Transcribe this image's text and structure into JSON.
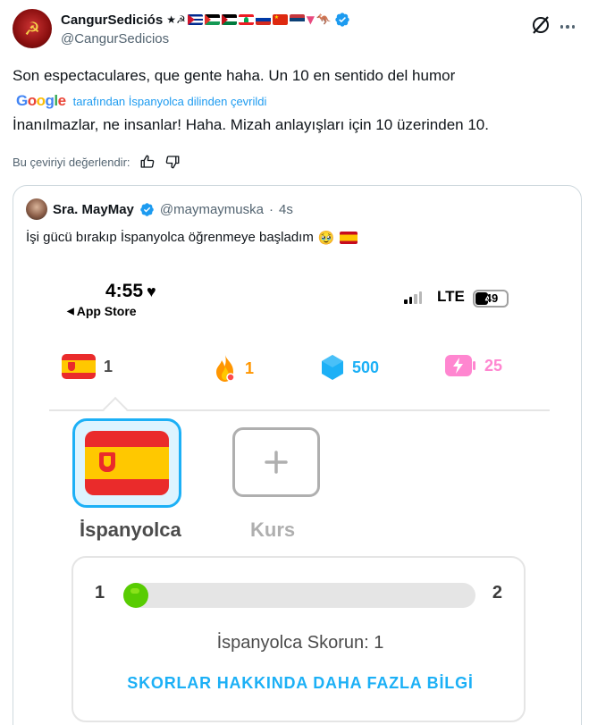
{
  "post": {
    "author": {
      "display_name": "CangurSediciós",
      "symbols": "★☭",
      "handle": "@CangurSedicios"
    },
    "text": "Son espectaculares, que gente haha. Un 10 en sentido del humor",
    "translation_provider": "Google",
    "translated_by": "tarafından İspanyolca dilinden çevrildi",
    "translation": "İnanılmazlar, ne insanlar! Haha. Mizah anlayışları için 10 üzerinden 10.",
    "rate_translation": "Bu çeviriyi değerlendir:"
  },
  "quote": {
    "display_name": "Sra. MayMay",
    "handle": "@maymaymuska",
    "separator": "·",
    "age": "4s",
    "text": "İşi gücü bırakıp İspanyolca öğrenmeye başladım",
    "emoji": "🥹"
  },
  "app": {
    "status": {
      "time": "4:55",
      "back_label": "App Store",
      "network": "LTE",
      "battery": "49"
    },
    "stats": {
      "courses": "1",
      "streak": "1",
      "gems": "500",
      "energy": "25"
    },
    "courses": [
      {
        "label": "İspanyolca"
      },
      {
        "label": "Kurs"
      }
    ],
    "score": {
      "from": "1",
      "to": "2",
      "progress": 0.06,
      "label": "İspanyolca Skorun: 1",
      "link": "SKORLAR HAKKINDA DAHA FAZLA BİLGİ"
    }
  },
  "colors": {
    "link_blue": "#1d9bf0",
    "duo_blue": "#1cb0f6",
    "duo_green": "#58cc02",
    "streak_orange": "#ff9600",
    "gem_blue": "#1cb0f6",
    "energy_pink": "#ff4b9e"
  }
}
